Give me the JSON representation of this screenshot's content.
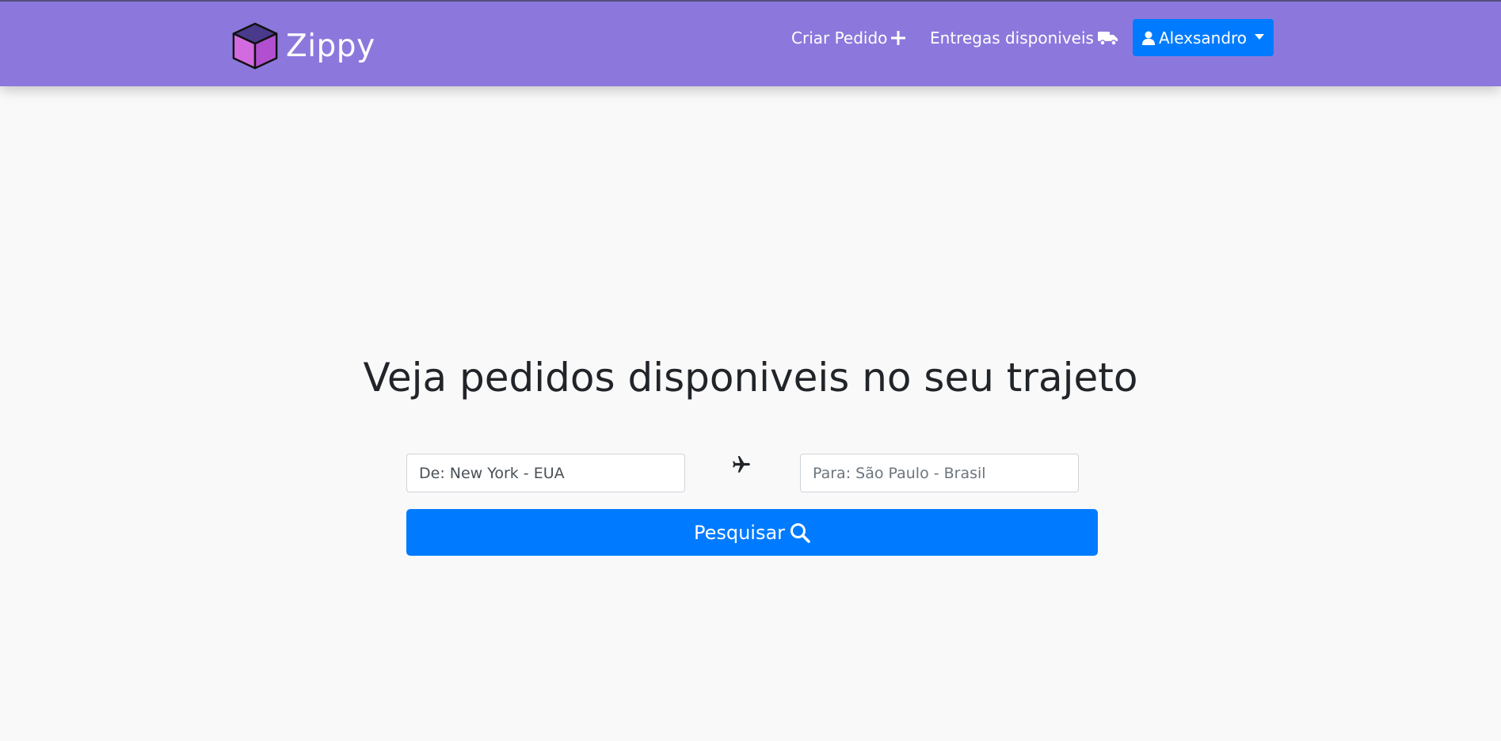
{
  "navbar": {
    "brand": {
      "name": "Zippy",
      "logo_icon": "cube-logo-icon"
    },
    "links": [
      {
        "label": "Criar Pedido",
        "icon": "plus-icon"
      },
      {
        "label": "Entregas disponiveis",
        "icon": "truck-icon"
      }
    ],
    "user": {
      "name": "Alexsandro",
      "icon": "user-icon"
    },
    "colors": {
      "background": "#8c78dc",
      "user_button": "#007bff"
    }
  },
  "main": {
    "headline": "Veja pedidos disponiveis no seu trajeto",
    "from": {
      "value": "De: New York - EUA",
      "placeholder": ""
    },
    "swap_icon": "airplane-icon",
    "to": {
      "value": "",
      "placeholder": "Para: São Paulo - Brasil"
    },
    "search_label": "Pesquisar",
    "search_icon": "search-icon",
    "colors": {
      "primary": "#007bff"
    }
  }
}
